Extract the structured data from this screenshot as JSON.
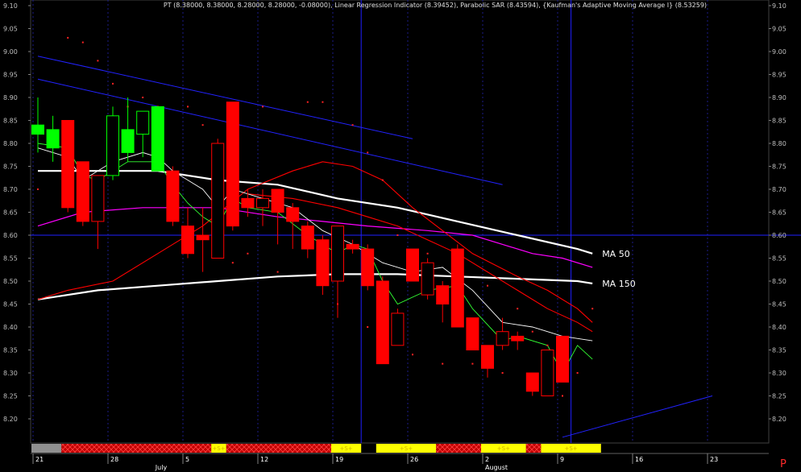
{
  "chart_data": {
    "type": "candlestick",
    "title": "PT (8.38000, 8.38000, 8.28000, 8.28000, -0.08000), Linear Regression Indicator (8.39452), Parabolic SAR (8.43594), {Kaufman's Adaptive Moving Average I} (8.53259)",
    "ylim": [
      8.15,
      9.12
    ],
    "y_ticks": [
      "9.10",
      "9.05",
      "9.00",
      "8.95",
      "8.90",
      "8.85",
      "8.80",
      "8.75",
      "8.70",
      "8.65",
      "8.60",
      "8.55",
      "8.50",
      "8.45",
      "8.40",
      "8.35",
      "8.30",
      "8.25",
      "8.20"
    ],
    "x_range": [
      0,
      49
    ],
    "x_ticks": [
      {
        "i": 0,
        "label": "21"
      },
      {
        "i": 5,
        "label": "28"
      },
      {
        "i": 10,
        "label": "5"
      },
      {
        "i": 15,
        "label": "12"
      },
      {
        "i": 20,
        "label": "19"
      },
      {
        "i": 25,
        "label": "26"
      },
      {
        "i": 30,
        "label": "2"
      },
      {
        "i": 35,
        "label": "9"
      },
      {
        "i": 40,
        "label": "16"
      },
      {
        "i": 45,
        "label": "23"
      }
    ],
    "month_labels": [
      {
        "i": 8,
        "label": "July"
      },
      {
        "i": 30,
        "label": "August"
      }
    ],
    "candles": [
      {
        "o": 8.82,
        "h": 8.9,
        "l": 8.78,
        "c": 8.84,
        "color": "#00ff00",
        "fill": true
      },
      {
        "o": 8.79,
        "h": 8.86,
        "l": 8.76,
        "c": 8.83,
        "color": "#00ff00",
        "fill": true
      },
      {
        "o": 8.85,
        "h": 8.85,
        "l": 8.65,
        "c": 8.66,
        "color": "#ff0000",
        "fill": true
      },
      {
        "o": 8.76,
        "h": 8.76,
        "l": 8.62,
        "c": 8.63,
        "color": "#ff0000",
        "fill": true
      },
      {
        "o": 8.63,
        "h": 8.73,
        "l": 8.57,
        "c": 8.73,
        "color": "#ff0000",
        "fill": false
      },
      {
        "o": 8.73,
        "h": 8.88,
        "l": 8.72,
        "c": 8.86,
        "color": "#00ff00",
        "fill": false
      },
      {
        "o": 8.78,
        "h": 8.9,
        "l": 8.76,
        "c": 8.83,
        "color": "#00ff00",
        "fill": true
      },
      {
        "o": 8.82,
        "h": 8.87,
        "l": 8.77,
        "c": 8.87,
        "color": "#00ff00",
        "fill": false
      },
      {
        "o": 8.74,
        "h": 8.88,
        "l": 8.74,
        "c": 8.88,
        "color": "#00ff00",
        "fill": true
      },
      {
        "o": 8.74,
        "h": 8.75,
        "l": 8.62,
        "c": 8.63,
        "color": "#ff0000",
        "fill": true
      },
      {
        "o": 8.62,
        "h": 8.66,
        "l": 8.55,
        "c": 8.56,
        "color": "#ff0000",
        "fill": true
      },
      {
        "o": 8.59,
        "h": 8.66,
        "l": 8.52,
        "c": 8.6,
        "color": "#ff0000",
        "fill": true
      },
      {
        "o": 8.8,
        "h": 8.81,
        "l": 8.55,
        "c": 8.55,
        "color": "#ff0000",
        "fill": false
      },
      {
        "o": 8.89,
        "h": 8.89,
        "l": 8.61,
        "c": 8.62,
        "color": "#ff0000",
        "fill": true
      },
      {
        "o": 8.68,
        "h": 8.7,
        "l": 8.64,
        "c": 8.66,
        "color": "#ff0000",
        "fill": true
      },
      {
        "o": 8.66,
        "h": 8.7,
        "l": 8.62,
        "c": 8.68,
        "color": "#ff0000",
        "fill": false
      },
      {
        "o": 8.7,
        "h": 8.7,
        "l": 8.58,
        "c": 8.65,
        "color": "#ff0000",
        "fill": true
      },
      {
        "o": 8.66,
        "h": 8.67,
        "l": 8.57,
        "c": 8.63,
        "color": "#ff0000",
        "fill": true
      },
      {
        "o": 8.62,
        "h": 8.63,
        "l": 8.55,
        "c": 8.57,
        "color": "#ff0000",
        "fill": true
      },
      {
        "o": 8.59,
        "h": 8.6,
        "l": 8.47,
        "c": 8.49,
        "color": "#ff0000",
        "fill": true
      },
      {
        "o": 8.5,
        "h": 8.62,
        "l": 8.42,
        "c": 8.62,
        "color": "#ff0000",
        "fill": false
      },
      {
        "o": 8.58,
        "h": 8.59,
        "l": 8.56,
        "c": 8.57,
        "color": "#ff0000",
        "fill": true
      },
      {
        "o": 8.57,
        "h": 8.58,
        "l": 8.48,
        "c": 8.49,
        "color": "#ff0000",
        "fill": true
      },
      {
        "o": 8.5,
        "h": 8.51,
        "l": 8.32,
        "c": 8.32,
        "color": "#ff0000",
        "fill": true
      },
      {
        "o": 8.43,
        "h": 8.44,
        "l": 8.36,
        "c": 8.36,
        "color": "#ff0000",
        "fill": false
      },
      {
        "o": 8.57,
        "h": 8.57,
        "l": 8.5,
        "c": 8.5,
        "color": "#ff0000",
        "fill": true
      },
      {
        "o": 8.54,
        "h": 8.55,
        "l": 8.46,
        "c": 8.47,
        "color": "#ff0000",
        "fill": false
      },
      {
        "o": 8.49,
        "h": 8.5,
        "l": 8.41,
        "c": 8.45,
        "color": "#ff0000",
        "fill": true
      },
      {
        "o": 8.57,
        "h": 8.58,
        "l": 8.4,
        "c": 8.4,
        "color": "#ff0000",
        "fill": true
      },
      {
        "o": 8.42,
        "h": 8.42,
        "l": 8.35,
        "c": 8.35,
        "color": "#ff0000",
        "fill": true
      },
      {
        "o": 8.36,
        "h": 8.36,
        "l": 8.29,
        "c": 8.31,
        "color": "#ff0000",
        "fill": true
      },
      {
        "o": 8.39,
        "h": 8.42,
        "l": 8.35,
        "c": 8.36,
        "color": "#ff0000",
        "fill": false
      },
      {
        "o": 8.38,
        "h": 8.39,
        "l": 8.35,
        "c": 8.37,
        "color": "#ff0000",
        "fill": true
      },
      {
        "o": 8.3,
        "h": 8.3,
        "l": 8.25,
        "c": 8.26,
        "color": "#ff0000",
        "fill": true
      },
      {
        "o": 8.35,
        "h": 8.35,
        "l": 8.25,
        "c": 8.25,
        "color": "#ff0000",
        "fill": false
      },
      {
        "o": 8.38,
        "h": 8.38,
        "l": 8.28,
        "c": 8.28,
        "color": "#ff0000",
        "fill": true
      }
    ],
    "series": [
      {
        "color": "#ffffff",
        "width": 2.2,
        "label": "MA 50",
        "points": [
          [
            0,
            8.74
          ],
          [
            4,
            8.74
          ],
          [
            8,
            8.74
          ],
          [
            12,
            8.72
          ],
          [
            16,
            8.71
          ],
          [
            20,
            8.68
          ],
          [
            24,
            8.66
          ],
          [
            28,
            8.63
          ],
          [
            32,
            8.6
          ],
          [
            36,
            8.57
          ],
          [
            37,
            8.56
          ]
        ]
      },
      {
        "color": "#ffffff",
        "width": 2.2,
        "label": "MA 150",
        "points": [
          [
            0,
            8.46
          ],
          [
            4,
            8.48
          ],
          [
            8,
            8.49
          ],
          [
            12,
            8.5
          ],
          [
            16,
            8.51
          ],
          [
            20,
            8.515
          ],
          [
            24,
            8.515
          ],
          [
            28,
            8.51
          ],
          [
            32,
            8.505
          ],
          [
            36,
            8.5
          ],
          [
            37,
            8.495
          ]
        ]
      },
      {
        "color": "#ff00ff",
        "width": 1.2,
        "points": [
          [
            0,
            8.62
          ],
          [
            3,
            8.65
          ],
          [
            7,
            8.66
          ],
          [
            12,
            8.66
          ],
          [
            16,
            8.64
          ],
          [
            19,
            8.63
          ],
          [
            22,
            8.62
          ],
          [
            26,
            8.61
          ],
          [
            29,
            8.6
          ],
          [
            31,
            8.58
          ],
          [
            33,
            8.56
          ],
          [
            35,
            8.55
          ],
          [
            37,
            8.53
          ]
        ]
      },
      {
        "color": "#ff0000",
        "width": 1.1,
        "points": [
          [
            0,
            8.46
          ],
          [
            2,
            8.48
          ],
          [
            5,
            8.5
          ],
          [
            8,
            8.56
          ],
          [
            11,
            8.62
          ],
          [
            14,
            8.7
          ],
          [
            17,
            8.74
          ],
          [
            19,
            8.76
          ],
          [
            21,
            8.75
          ],
          [
            23,
            8.72
          ],
          [
            25,
            8.66
          ],
          [
            27,
            8.61
          ],
          [
            29,
            8.56
          ],
          [
            32,
            8.51
          ],
          [
            34,
            8.48
          ],
          [
            36,
            8.44
          ],
          [
            37,
            8.41
          ]
        ]
      },
      {
        "color": "#ff0000",
        "width": 1.1,
        "points": [
          [
            14,
            8.69
          ],
          [
            17,
            8.68
          ],
          [
            20,
            8.66
          ],
          [
            22,
            8.64
          ],
          [
            24,
            8.62
          ],
          [
            26,
            8.59
          ],
          [
            28,
            8.56
          ],
          [
            30,
            8.52
          ],
          [
            32,
            8.48
          ],
          [
            34,
            8.44
          ],
          [
            36,
            8.41
          ],
          [
            37,
            8.39
          ]
        ]
      },
      {
        "color": "#ffffff",
        "width": 0.9,
        "points": [
          [
            0,
            8.79
          ],
          [
            2,
            8.77
          ],
          [
            3,
            8.72
          ],
          [
            5,
            8.76
          ],
          [
            7,
            8.78
          ],
          [
            8,
            8.77
          ],
          [
            9,
            8.74
          ],
          [
            11,
            8.7
          ],
          [
            12,
            8.66
          ],
          [
            13,
            8.7
          ],
          [
            15,
            8.68
          ],
          [
            17,
            8.66
          ],
          [
            19,
            8.61
          ],
          [
            21,
            8.58
          ],
          [
            23,
            8.54
          ],
          [
            25,
            8.52
          ],
          [
            27,
            8.53
          ],
          [
            29,
            8.48
          ],
          [
            31,
            8.41
          ],
          [
            33,
            8.4
          ],
          [
            35,
            8.38
          ],
          [
            37,
            8.37
          ]
        ]
      },
      {
        "color": "#33ff33",
        "width": 0.9,
        "points": [
          [
            0,
            8.8
          ],
          [
            2,
            8.79
          ],
          [
            3,
            8.73
          ],
          [
            4,
            8.72
          ],
          [
            6,
            8.76
          ],
          [
            8,
            8.76
          ],
          [
            9,
            8.71
          ],
          [
            10,
            8.67
          ],
          [
            11,
            8.64
          ],
          [
            12,
            8.62
          ],
          [
            13,
            8.68
          ],
          [
            14,
            8.66
          ],
          [
            16,
            8.65
          ],
          [
            18,
            8.6
          ],
          [
            20,
            8.56
          ],
          [
            21,
            8.58
          ],
          [
            22,
            8.57
          ],
          [
            23,
            8.5
          ],
          [
            24,
            8.45
          ],
          [
            26,
            8.48
          ],
          [
            28,
            8.49
          ],
          [
            29,
            8.44
          ],
          [
            31,
            8.37
          ],
          [
            32,
            8.38
          ],
          [
            34,
            8.36
          ],
          [
            35,
            8.3
          ],
          [
            36,
            8.36
          ],
          [
            37,
            8.33
          ]
        ]
      }
    ],
    "trend_lines": [
      {
        "from": [
          0,
          8.99
        ],
        "to": [
          25,
          8.81
        ]
      },
      {
        "from": [
          0,
          8.94
        ],
        "to": [
          31,
          8.71
        ]
      },
      {
        "from": [
          35,
          8.16
        ],
        "to": [
          45,
          8.25
        ]
      }
    ],
    "sar_dots": [
      [
        2,
        9.03
      ],
      [
        3,
        9.02
      ],
      [
        4,
        8.98
      ],
      [
        5,
        8.93
      ],
      [
        6,
        8.88
      ],
      [
        7,
        8.9
      ],
      [
        8,
        8.88
      ],
      [
        10,
        8.88
      ],
      [
        11,
        8.84
      ],
      [
        12,
        8.77
      ],
      [
        15,
        8.88
      ],
      [
        18,
        8.89
      ],
      [
        19,
        8.89
      ],
      [
        21,
        8.84
      ],
      [
        22,
        8.78
      ],
      [
        23,
        8.72
      ],
      [
        24,
        8.6
      ],
      [
        26,
        8.56
      ],
      [
        28,
        8.54
      ],
      [
        30,
        8.49
      ],
      [
        32,
        8.44
      ],
      [
        33,
        8.39
      ],
      [
        34,
        8.36
      ],
      [
        36,
        8.3
      ],
      [
        37,
        8.44
      ],
      [
        0,
        8.7
      ],
      [
        13,
        8.54
      ],
      [
        14,
        8.56
      ],
      [
        16,
        8.52
      ],
      [
        20,
        8.45
      ],
      [
        22,
        8.4
      ],
      [
        24,
        8.4
      ],
      [
        25,
        8.34
      ],
      [
        27,
        8.32
      ],
      [
        29,
        8.32
      ],
      [
        31,
        8.3
      ],
      [
        35,
        8.25
      ]
    ],
    "h_line": 8.6,
    "v_lines": [
      22,
      36
    ],
    "bottom_strip": [
      {
        "from": 0,
        "to": 2,
        "type": "gray"
      },
      {
        "from": 2,
        "to": 12,
        "type": "hatch"
      },
      {
        "from": 12,
        "to": 13,
        "type": "yellow",
        "text": "+S+"
      },
      {
        "from": 13,
        "to": 20,
        "type": "hatch"
      },
      {
        "from": 20,
        "to": 22,
        "type": "yellow",
        "text": "+S+"
      },
      {
        "from": 23,
        "to": 27,
        "type": "yellow",
        "text": "+S+"
      },
      {
        "from": 27,
        "to": 30,
        "type": "hatch"
      },
      {
        "from": 30,
        "to": 33,
        "type": "yellow",
        "text": "+S+"
      },
      {
        "from": 33,
        "to": 34,
        "type": "hatch"
      },
      {
        "from": 34,
        "to": 38,
        "type": "yellow",
        "text": "+S+"
      }
    ],
    "corner_label": "P"
  }
}
